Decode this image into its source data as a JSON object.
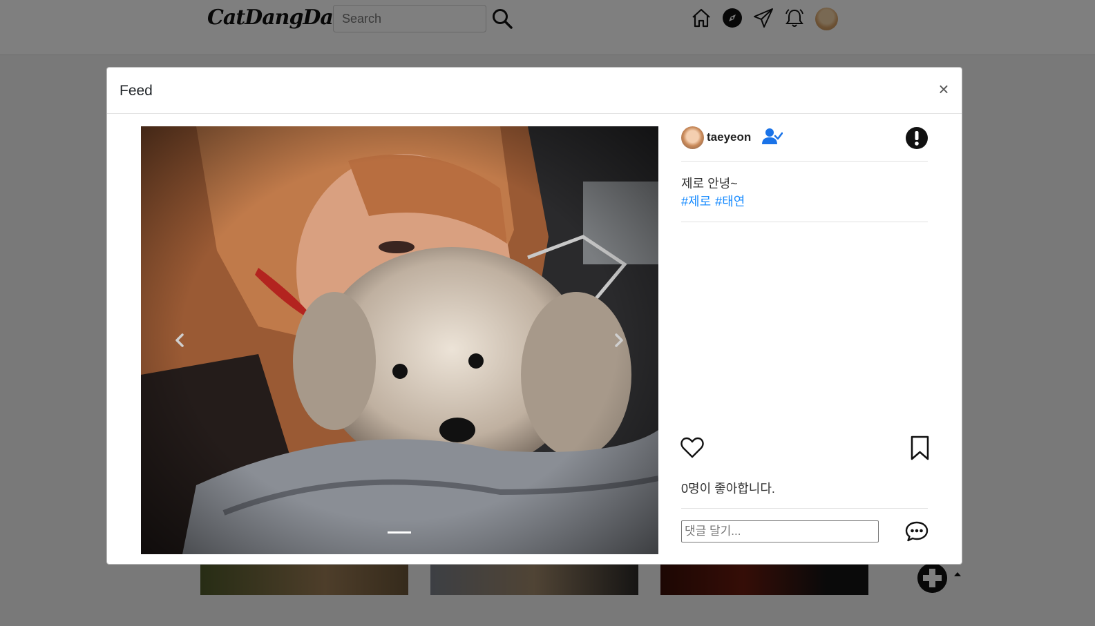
{
  "navbar": {
    "logo": "CatDangDang",
    "search_placeholder": "Search",
    "icons": [
      "search-icon",
      "home-icon",
      "explore-compass-icon",
      "send-paper-plane-icon",
      "notifications-bell-icon",
      "profile-avatar"
    ]
  },
  "modal": {
    "title": "Feed",
    "close_label": "×"
  },
  "carousel": {
    "prev_icon": "chevron-left-icon",
    "next_icon": "chevron-right-icon",
    "indicators": 1,
    "active_indicator": 1
  },
  "post": {
    "author": "taeyeon",
    "caption": "제로 안녕~",
    "hashtags": [
      "#제로",
      "#태연"
    ],
    "likes_text": "0명이 좋아합니다.",
    "comment_placeholder": "댓글 달기..."
  },
  "colors": {
    "accent": "#1a8cff",
    "follow_icon": "#1a73e8",
    "backdrop": "rgba(0,0,0,0.5)"
  }
}
